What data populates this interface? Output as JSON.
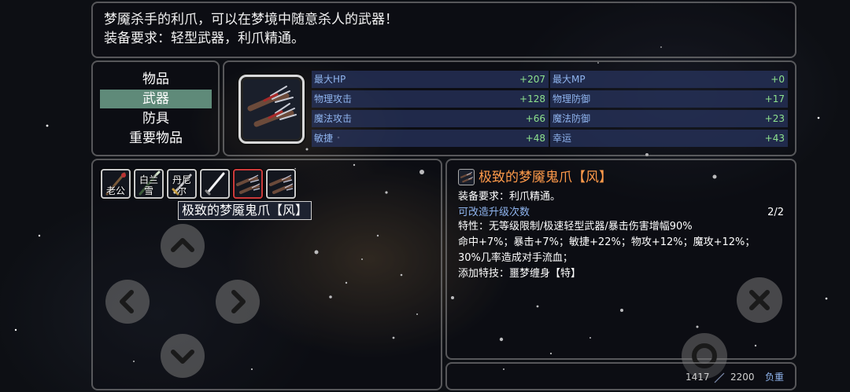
{
  "description": {
    "line1": "梦魇杀手的利爪，可以在梦境中随意杀人的武器！",
    "line2": "装备要求：轻型武器，利爪精通。"
  },
  "categories": [
    {
      "label": "物品",
      "active": false
    },
    {
      "label": "武器",
      "active": true
    },
    {
      "label": "防具",
      "active": false
    },
    {
      "label": "重要物品",
      "active": false
    }
  ],
  "stats": [
    {
      "label": "最大HP",
      "value": "+207"
    },
    {
      "label": "最大MP",
      "value": "+0"
    },
    {
      "label": "物理攻击",
      "value": "+128"
    },
    {
      "label": "物理防御",
      "value": "+17"
    },
    {
      "label": "魔法攻击",
      "value": "+66"
    },
    {
      "label": "魔法防御",
      "value": "+23"
    },
    {
      "label": "敏捷",
      "value": "+48"
    },
    {
      "label": "幸运",
      "value": "+43"
    }
  ],
  "inventory": [
    {
      "label": "老公",
      "icon": "staff-icon"
    },
    {
      "label": "白兰雪",
      "icon": "spear-icon"
    },
    {
      "label": "丹尼尔",
      "icon": "sword-icon"
    },
    {
      "label": "",
      "icon": "dagger-icon"
    },
    {
      "label": "",
      "icon": "claw-icon",
      "selected": true
    },
    {
      "label": "",
      "icon": "claw-icon"
    }
  ],
  "tooltip": "极致的梦魇鬼爪【风】",
  "detail": {
    "name": "极致的梦魇鬼爪【风】",
    "requirement": "装备要求：利爪精通。",
    "upgrade_label": "可改造升级次数",
    "upgrade_count": "2/2",
    "trait": "特性：无等级限制/极速轻型武器/暴击伤害增幅90%",
    "bonuses": "命中+7%；暴击+7%；敏捷+22%；物攻+12%；魔攻+12%；",
    "bleed": "30%几率造成对手流血；",
    "skill": "添加特技：噩梦缠身【特】"
  },
  "weight": {
    "current": "1417",
    "max": "2200",
    "label": "负重"
  },
  "colors": {
    "active_category": "#5f8a79",
    "stat_label": "#8fb4ee",
    "stat_value": "#8ee38e",
    "item_name": "#ff9a4a",
    "selected_slot_border": "#cc3b3b"
  }
}
